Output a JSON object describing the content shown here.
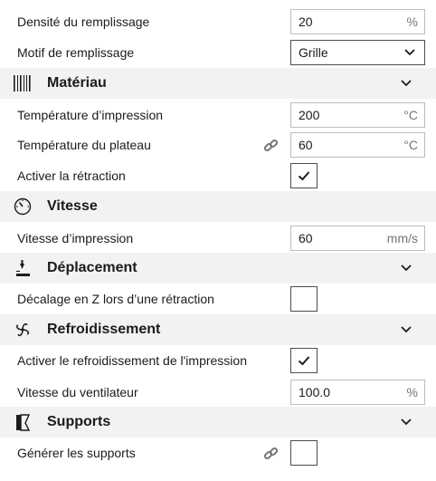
{
  "rows": {
    "infill_density": {
      "label": "Densité du remplissage",
      "value": "20",
      "unit": "%"
    },
    "infill_pattern": {
      "label": "Motif de remplissage",
      "value": "Grille"
    },
    "print_temp": {
      "label": "Température d’impression",
      "value": "200",
      "unit": "°C"
    },
    "bed_temp": {
      "label": "Température du plateau",
      "value": "60",
      "unit": "°C"
    },
    "retraction": {
      "label": "Activer la rétraction",
      "checked": true
    },
    "print_speed": {
      "label": "Vitesse d’impression",
      "value": "60",
      "unit": "mm/s"
    },
    "z_hop": {
      "label": "Décalage en Z lors d’une rétraction",
      "checked": false
    },
    "cooling_enable": {
      "label": "Activer le refroidissement de l'impression",
      "checked": true
    },
    "fan_speed": {
      "label": "Vitesse du ventilateur",
      "value": "100.0",
      "unit": "%"
    },
    "supports": {
      "label": "Générer les supports",
      "checked": false
    }
  },
  "sections": {
    "material": {
      "title": "Matériau",
      "icon": "material-icon"
    },
    "speed": {
      "title": "Vitesse",
      "icon": "speedometer-icon"
    },
    "travel": {
      "title": "Déplacement",
      "icon": "travel-icon"
    },
    "cooling": {
      "title": "Refroidissement",
      "icon": "fan-icon"
    },
    "support": {
      "title": "Supports",
      "icon": "support-icon"
    }
  },
  "colors": {
    "section_bg": "#f2f2f2",
    "text": "#1b1b1b",
    "unit": "#757575",
    "border": "#bdbdbd"
  }
}
